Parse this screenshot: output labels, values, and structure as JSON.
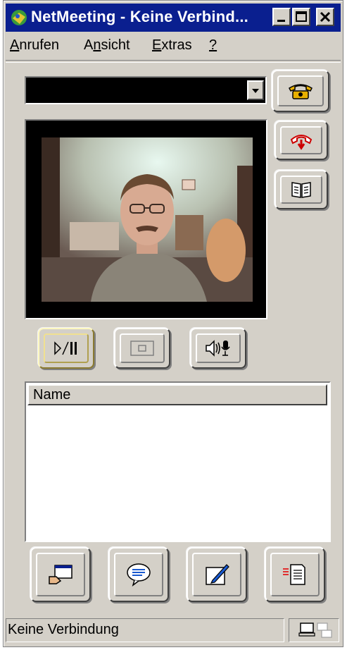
{
  "window": {
    "title": "NetMeeting - Keine Verbind..."
  },
  "menu": {
    "items": [
      {
        "label": "Anrufen",
        "mnemonic": "A"
      },
      {
        "label": "Ansicht",
        "mnemonic": "n"
      },
      {
        "label": "Extras",
        "mnemonic": "E"
      },
      {
        "label": "?",
        "mnemonic": "?"
      }
    ]
  },
  "address": {
    "value": ""
  },
  "participants": {
    "column_name": "Name",
    "rows": []
  },
  "status": {
    "text": "Keine Verbindung"
  },
  "icons": {
    "call": "phone-dial-icon",
    "hangup": "hang-up-icon",
    "directory": "address-book-icon",
    "playpause": "play-pause-icon",
    "pip": "picture-in-picture-icon",
    "volume": "speaker-mic-icon",
    "share": "share-program-icon",
    "chat": "chat-icon",
    "whiteboard": "whiteboard-icon",
    "transfer": "file-transfer-icon"
  }
}
